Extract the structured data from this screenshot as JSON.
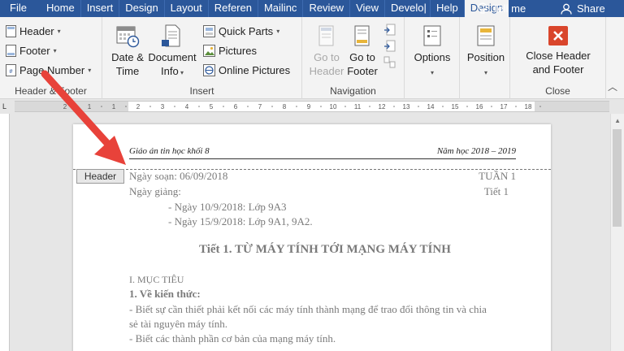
{
  "tabs": [
    {
      "label": "File",
      "active": false
    },
    {
      "label": "Home",
      "active": false
    },
    {
      "label": "Insert",
      "active": false
    },
    {
      "label": "Design",
      "active": false
    },
    {
      "label": "Layout",
      "active": false
    },
    {
      "label": "Referen",
      "active": false
    },
    {
      "label": "Mailinc",
      "active": false
    },
    {
      "label": "Review",
      "active": false
    },
    {
      "label": "View",
      "active": false
    },
    {
      "label": "Develo|",
      "active": false
    },
    {
      "label": "Help",
      "active": false
    },
    {
      "label": "Design",
      "active": true
    }
  ],
  "tell_me": "Tell me",
  "share": "Share",
  "ribbon": {
    "header_footer_group": {
      "label": "Header & Footer",
      "header": "Header",
      "footer": "Footer",
      "page_number": "Page Number"
    },
    "insert_group": {
      "label": "Insert",
      "date_time_1": "Date &",
      "date_time_2": "Time",
      "document_info_1": "Document",
      "document_info_2": "Info",
      "quick_parts": "Quick Parts",
      "pictures": "Pictures",
      "online_pictures": "Online Pictures"
    },
    "navigation_group": {
      "label": "Navigation",
      "goto_header_1": "Go to",
      "goto_header_2": "Header",
      "goto_footer_1": "Go to",
      "goto_footer_2": "Footer"
    },
    "options": "Options",
    "position": "Position",
    "close_group": {
      "label": "Close",
      "close_1": "Close Header",
      "close_2": "and Footer"
    }
  },
  "ruler_numbers": [
    "2",
    "1",
    "1",
    "2",
    "3",
    "4",
    "5",
    "6",
    "7",
    "8",
    "9",
    "10",
    "11",
    "12",
    "13",
    "14",
    "15",
    "16",
    "17",
    "18"
  ],
  "document": {
    "header_left": "Giáo án tin học khối 8",
    "header_right": "Năm học 2018 – 2019",
    "header_tag": "Header",
    "line1_left": "Ngày soạn: 06/09/2018",
    "line1_right": "TUẦN 1",
    "line2_left": "Ngày giảng:",
    "line2_right": "Tiết 1",
    "line3": "- Ngày 10/9/2018: Lớp 9A3",
    "line4": "- Ngày 15/9/2018: Lớp 9A1, 9A2.",
    "title": "Tiết 1. TỪ MÁY TÍNH TỚI MẠNG MÁY TÍNH",
    "section1": "I. MỤC TIÊU",
    "section1_1": "1. Về kiến thức:",
    "para1": "- Biết sự cần thiết phải kết nối các máy tính thành mạng để trao đổi thông tin và chia",
    "para1b": "sẻ tài nguyên máy tính.",
    "para2": "- Biết các thành phần cơ bản của mạng máy tính."
  },
  "colors": {
    "tab_bar": "#2b579a",
    "arrow": "#e8423a",
    "close_icon": "#d9452b"
  }
}
